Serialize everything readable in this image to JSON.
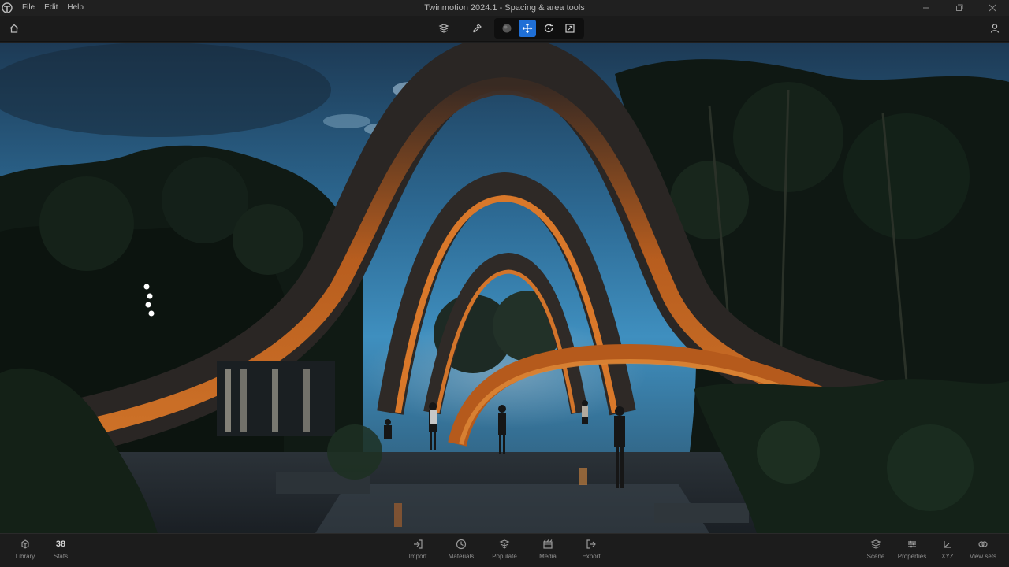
{
  "window": {
    "title": "Twinmotion 2024.1 - Spacing & area tools"
  },
  "menu": {
    "items": [
      "File",
      "Edit",
      "Help"
    ]
  },
  "toolbar": {
    "active_tool": "move-tool"
  },
  "bottom_left": {
    "library_label": "Library",
    "stats_label": "Stats",
    "stats_count": "38"
  },
  "bottom_center": {
    "items": [
      "Import",
      "Materials",
      "Populate",
      "Media",
      "Export"
    ]
  },
  "bottom_right": {
    "items": [
      "Scene",
      "Properties",
      "XYZ",
      "View sets"
    ]
  },
  "colors": {
    "accent": "#1f6fd6",
    "panel": "#1c1c1c"
  }
}
